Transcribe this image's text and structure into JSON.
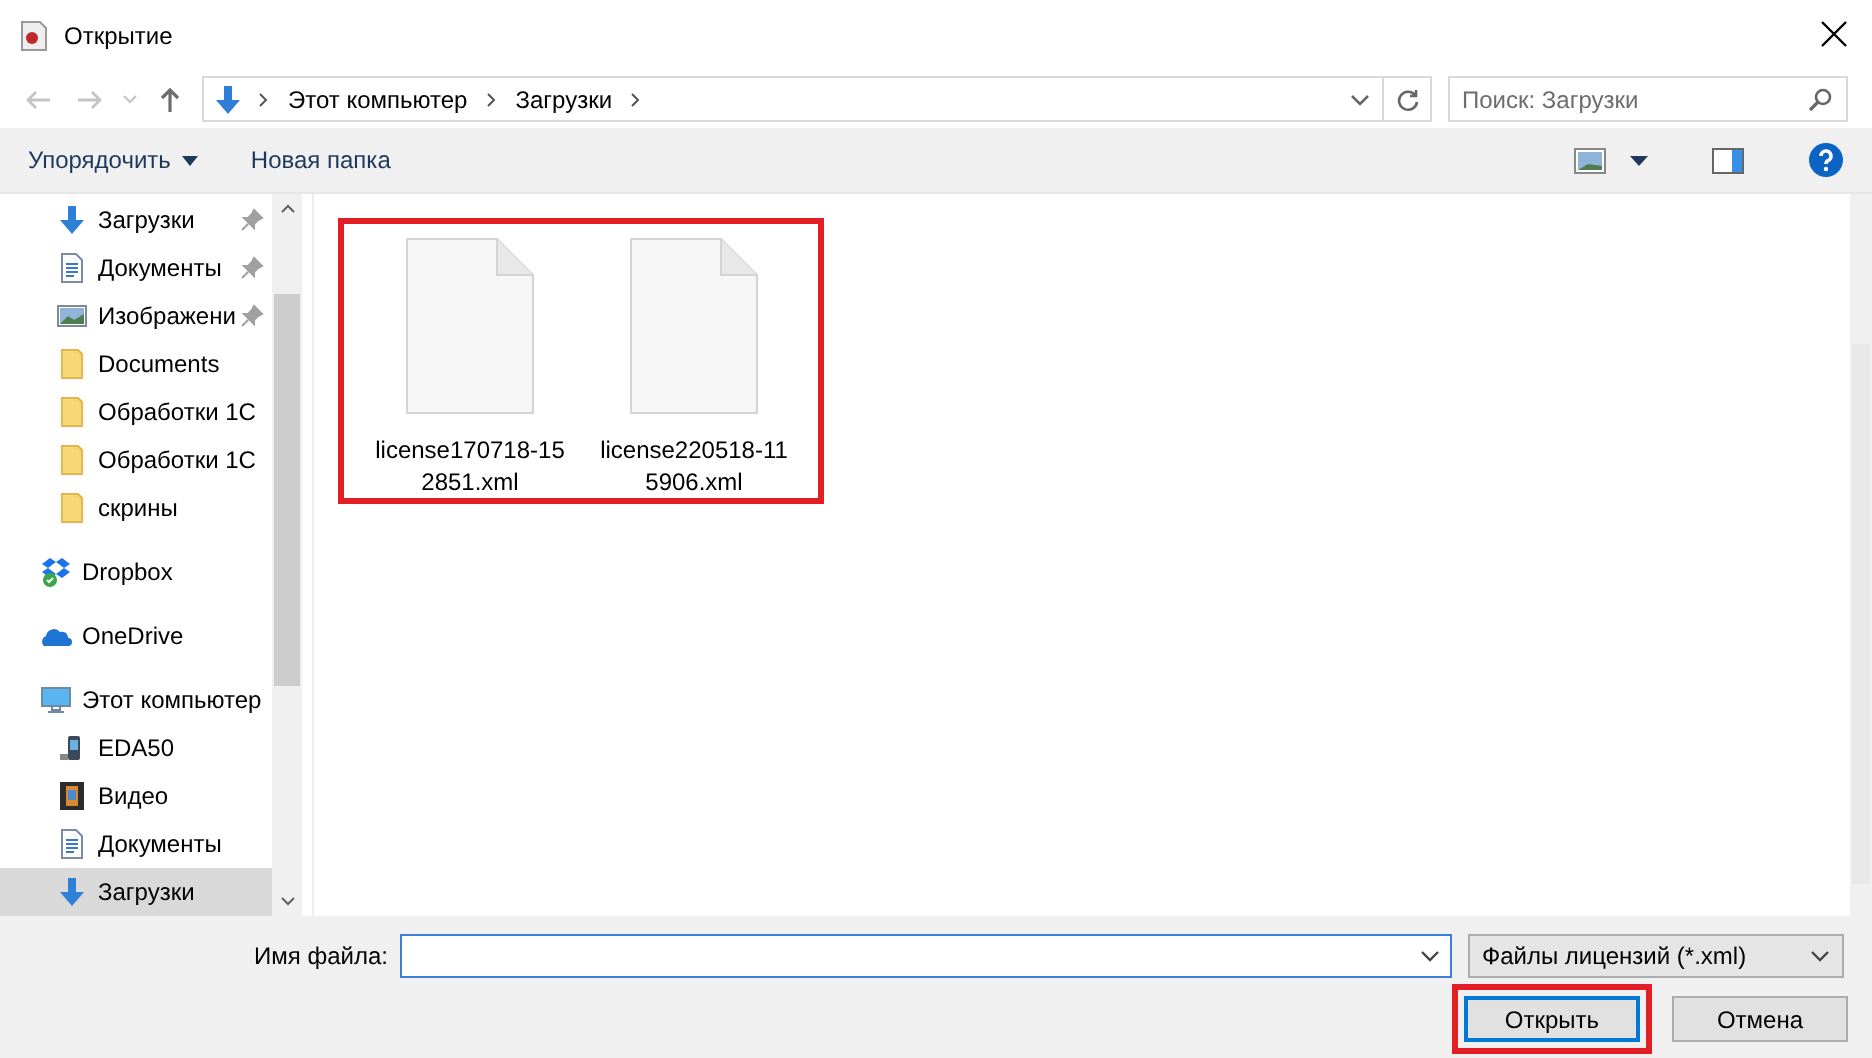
{
  "window": {
    "title": "Открытие"
  },
  "nav": {
    "path": [
      "Этот компьютер",
      "Загрузки"
    ],
    "search": {
      "placeholder": "Поиск: Загрузки"
    }
  },
  "toolbar": {
    "items": [
      "Упорядочить",
      "Новая папка"
    ]
  },
  "sidebar": {
    "quick_access": [
      {
        "label": "Загрузки",
        "kind": "download",
        "pinned": true,
        "selected": false
      },
      {
        "label": "Документы",
        "kind": "document",
        "pinned": true,
        "selected": false
      },
      {
        "label": "Изображени",
        "kind": "image",
        "pinned": true,
        "selected": false
      },
      {
        "label": "Documents",
        "kind": "folder",
        "pinned": false,
        "selected": false
      },
      {
        "label": "Обработки 1С",
        "kind": "folder",
        "pinned": false,
        "selected": false
      },
      {
        "label": "Обработки 1С",
        "kind": "folder",
        "pinned": false,
        "selected": false
      },
      {
        "label": "скрины",
        "kind": "folder",
        "pinned": false,
        "selected": false
      }
    ],
    "locations": [
      {
        "label": "Dropbox",
        "kind": "dropbox",
        "selected": false
      },
      {
        "label": "OneDrive",
        "kind": "onedrive",
        "selected": false
      },
      {
        "label": "Этот компьютер",
        "kind": "computer",
        "selected": false,
        "children": [
          {
            "label": "EDA50",
            "kind": "device",
            "selected": false
          },
          {
            "label": "Видео",
            "kind": "video",
            "selected": false
          },
          {
            "label": "Документы",
            "kind": "document",
            "selected": false
          },
          {
            "label": "Загрузки",
            "kind": "download",
            "selected": true
          }
        ]
      }
    ]
  },
  "files": {
    "highlighted": true,
    "items": [
      {
        "name": "license170718-152851.xml"
      },
      {
        "name": "license220518-115906.xml"
      }
    ]
  },
  "footer": {
    "filename_label": "Имя файла:",
    "file_type": "Файлы лицензий (*.xml)",
    "buttons": [
      {
        "label": "Открыть",
        "kind": "primary",
        "highlighted": true
      },
      {
        "label": "Отмена",
        "kind": "normal",
        "highlighted": false
      }
    ]
  }
}
